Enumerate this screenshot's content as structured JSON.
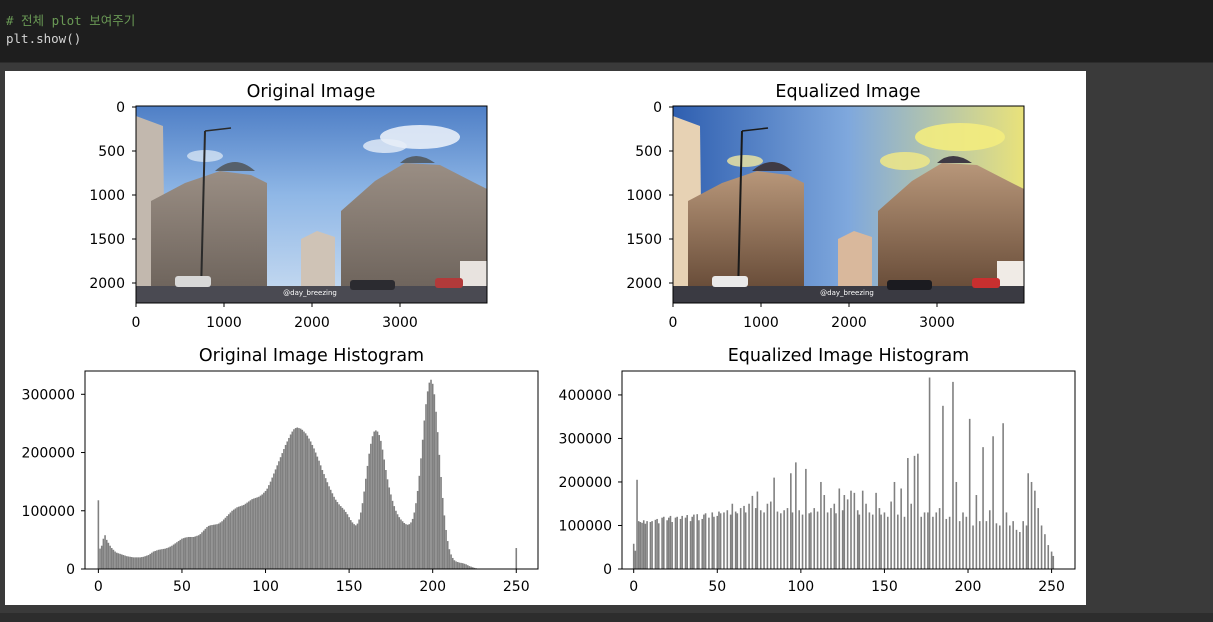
{
  "code": {
    "comment": "# 전체 plot 보여주기",
    "call": "plt.show()"
  },
  "figure": {
    "image_panels": [
      {
        "title": "Original Image",
        "watermark": "@day_breezing",
        "yticks": [
          "0",
          "500",
          "1000",
          "1500",
          "2000"
        ],
        "xticks": [
          "0",
          "1000",
          "2000",
          "3000"
        ],
        "image_note": "HDR street photo of Parisian Haussmann buildings with blue sky"
      },
      {
        "title": "Equalized Image",
        "watermark": "@day_breezing",
        "yticks": [
          "0",
          "500",
          "1000",
          "1500",
          "2000"
        ],
        "xticks": [
          "0",
          "1000",
          "2000",
          "3000"
        ],
        "image_note": "same photo after histogram equalization, brighter yellow sky"
      }
    ]
  },
  "chart_data": [
    {
      "type": "bar",
      "title": "Original Image Histogram",
      "xlabel": "",
      "ylabel": "",
      "xlim": [
        -8,
        263
      ],
      "ylim": [
        0,
        340000
      ],
      "xticks": [
        0,
        50,
        100,
        150,
        200,
        250
      ],
      "yticks": [
        0,
        100000,
        200000,
        300000
      ],
      "color": "#808080",
      "bins": 256,
      "values": [
        118000,
        35000,
        40000,
        52000,
        58000,
        50000,
        45000,
        40000,
        36000,
        33000,
        30000,
        28000,
        27000,
        26000,
        25000,
        24000,
        23000,
        22000,
        21500,
        21000,
        20500,
        20000,
        20000,
        20000,
        20000,
        20000,
        20500,
        21000,
        22000,
        23000,
        24000,
        26000,
        28000,
        30000,
        31000,
        32000,
        33000,
        33500,
        34000,
        34500,
        35000,
        36000,
        37000,
        38500,
        40000,
        42000,
        44000,
        46000,
        48000,
        50000,
        52000,
        53000,
        54000,
        54500,
        55000,
        55000,
        55000,
        55000,
        56000,
        57000,
        58000,
        60000,
        63000,
        66000,
        69000,
        72000,
        74000,
        75000,
        75500,
        76000,
        76500,
        77000,
        78000,
        80000,
        82000,
        85000,
        88000,
        91000,
        94000,
        97000,
        100000,
        102000,
        104000,
        106000,
        107000,
        108000,
        109000,
        110000,
        112000,
        114000,
        116000,
        118000,
        120000,
        121000,
        122000,
        123000,
        124000,
        126000,
        128000,
        131000,
        134000,
        138000,
        144000,
        150000,
        157000,
        164000,
        171000,
        178000,
        185000,
        192000,
        199000,
        206000,
        213000,
        219000,
        225000,
        231000,
        236000,
        240000,
        242000,
        243000,
        242000,
        241000,
        239000,
        236000,
        233000,
        229000,
        224000,
        219000,
        213000,
        207000,
        200000,
        193000,
        186000,
        178000,
        170000,
        163000,
        156000,
        149000,
        142000,
        136000,
        130000,
        124000,
        119000,
        115000,
        111000,
        108000,
        105000,
        102000,
        98000,
        94000,
        89000,
        84000,
        80000,
        77000,
        75000,
        78000,
        85000,
        97000,
        113000,
        133000,
        155000,
        177000,
        198000,
        215000,
        228000,
        236000,
        238000,
        236000,
        230000,
        220000,
        205000,
        188000,
        170000,
        154000,
        140000,
        128000,
        117000,
        108000,
        100000,
        94000,
        89000,
        85000,
        82000,
        79000,
        77000,
        76000,
        77000,
        80000,
        86000,
        97000,
        113000,
        134000,
        160000,
        190000,
        222000,
        255000,
        283000,
        305000,
        320000,
        325000,
        318000,
        300000,
        270000,
        235000,
        196000,
        158000,
        122000,
        92000,
        67000,
        48000,
        34000,
        25000,
        19000,
        15000,
        13000,
        12000,
        11000,
        10500,
        10000,
        9000,
        8000,
        6500,
        5000,
        4000,
        3000,
        2000,
        1300,
        800,
        500,
        300,
        200,
        100,
        50,
        0,
        0,
        0,
        0,
        0,
        0,
        0,
        0,
        0,
        0,
        0,
        0,
        0,
        0,
        0,
        0,
        0,
        36000
      ],
      "series": []
    },
    {
      "type": "bar",
      "title": "Equalized Image Histogram",
      "xlabel": "",
      "ylabel": "",
      "xlim": [
        -7,
        264
      ],
      "ylim": [
        0,
        455000
      ],
      "xticks": [
        0,
        50,
        100,
        150,
        200,
        250
      ],
      "yticks": [
        0,
        100000,
        200000,
        300000,
        400000
      ],
      "color": "#808080",
      "bins": 256,
      "values": [
        58000,
        42000,
        205000,
        110000,
        108000,
        106000,
        112000,
        104000,
        110000,
        0,
        108000,
        110000,
        0,
        113000,
        115000,
        105000,
        0,
        118000,
        120000,
        0,
        112000,
        118000,
        122000,
        108000,
        0,
        118000,
        120000,
        0,
        115000,
        122000,
        0,
        118000,
        124000,
        0,
        110000,
        120000,
        125000,
        0,
        126000,
        112000,
        0,
        115000,
        125000,
        128000,
        0,
        118000,
        0,
        130000,
        120000,
        0,
        122000,
        132000,
        128000,
        0,
        130000,
        0,
        135000,
        0,
        125000,
        150000,
        0,
        132000,
        128000,
        0,
        140000,
        0,
        145000,
        130000,
        0,
        150000,
        0,
        168000,
        0,
        140000,
        178000,
        0,
        135000,
        0,
        130000,
        0,
        150000,
        0,
        155000,
        0,
        210000,
        0,
        132000,
        0,
        128000,
        0,
        135000,
        0,
        140000,
        0,
        220000,
        130000,
        0,
        245000,
        0,
        135000,
        0,
        125000,
        0,
        230000,
        0,
        128000,
        130000,
        0,
        140000,
        0,
        132000,
        0,
        200000,
        0,
        170000,
        0,
        130000,
        0,
        140000,
        0,
        150000,
        128000,
        0,
        185000,
        0,
        135000,
        170000,
        0,
        160000,
        0,
        180000,
        0,
        175000,
        0,
        135000,
        125000,
        0,
        180000,
        0,
        150000,
        0,
        130000,
        0,
        125000,
        0,
        175000,
        0,
        140000,
        125000,
        0,
        130000,
        0,
        120000,
        0,
        155000,
        0,
        200000,
        0,
        125000,
        0,
        185000,
        0,
        120000,
        0,
        255000,
        0,
        150000,
        0,
        260000,
        0,
        265000,
        0,
        120000,
        0,
        130000,
        0,
        130000,
        440000,
        0,
        120000,
        0,
        130000,
        0,
        140000,
        0,
        375000,
        0,
        115000,
        0,
        120000,
        0,
        430000,
        0,
        200000,
        0,
        110000,
        0,
        130000,
        0,
        120000,
        0,
        345000,
        0,
        100000,
        0,
        170000,
        0,
        110000,
        0,
        280000,
        0,
        110000,
        0,
        135000,
        0,
        305000,
        0,
        105000,
        0,
        100000,
        0,
        335000,
        0,
        130000,
        0,
        100000,
        0,
        110000,
        0,
        90000,
        0,
        85000,
        0,
        110000,
        0,
        100000,
        220000,
        0,
        200000,
        0,
        180000,
        0,
        140000,
        0,
        100000,
        0,
        80000,
        0,
        55000,
        0,
        40000,
        30000
      ]
    }
  ]
}
